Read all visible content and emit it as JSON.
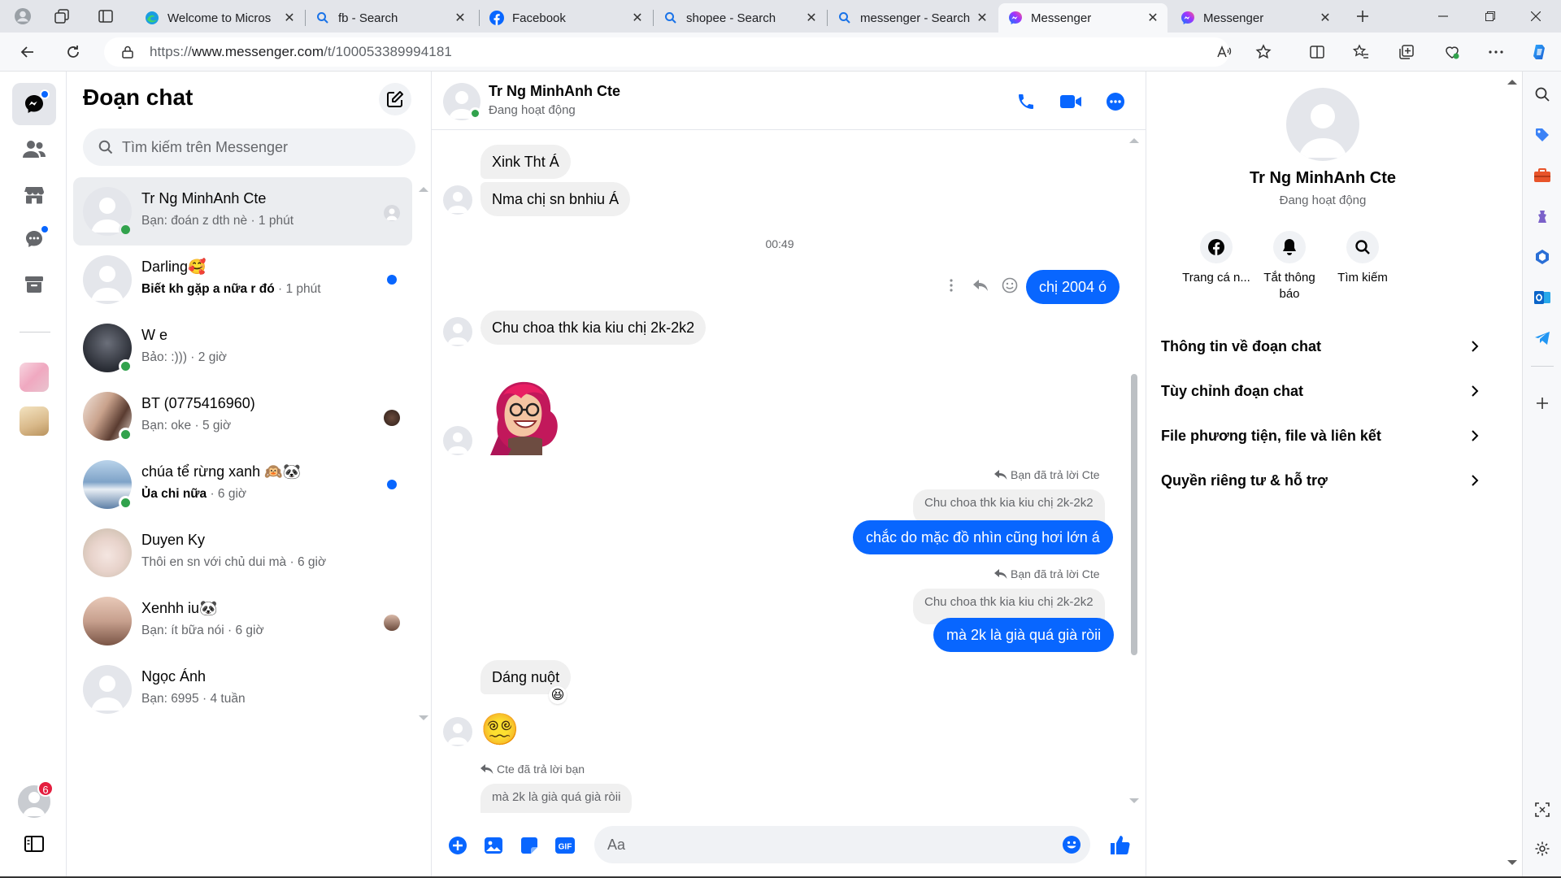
{
  "browser": {
    "tabs": [
      {
        "title": "Welcome to Micros",
        "icon": "edge-icon"
      },
      {
        "title": "fb - Search",
        "icon": "search-icon"
      },
      {
        "title": "Facebook",
        "icon": "facebook-icon"
      },
      {
        "title": "shopee - Search",
        "icon": "search-icon"
      },
      {
        "title": "messenger - Search",
        "icon": "search-icon"
      },
      {
        "title": "Messenger",
        "icon": "messenger-icon",
        "active": true
      },
      {
        "title": "Messenger",
        "icon": "messenger-icon"
      }
    ],
    "url_prefix": "https://",
    "url_host": "www.messenger.com",
    "url_path": "/t/100053389994181"
  },
  "rail": {
    "notification_count": "6"
  },
  "chat_list": {
    "title": "Đoạn chat",
    "search_placeholder": "Tìm kiếm trên Messenger",
    "conversations": [
      {
        "name": "Tr Ng MinhAnh Cte",
        "preview": "Bạn: đoán z dth nè",
        "time": "1 phút",
        "online": true,
        "active": true,
        "unread": false,
        "avatar_color": "#e4e6eb"
      },
      {
        "name": "Darling🥰",
        "preview": "Biết kh gặp a nữa r đó",
        "time": "1 phút",
        "online": false,
        "unread": true,
        "avatar_color": "#e4e6eb"
      },
      {
        "name": "W e",
        "preview": "Bảo: :)))",
        "time": "2 giờ",
        "online": true,
        "unread": false,
        "avatar_color": "#3a3f4a"
      },
      {
        "name": "BT (0775416960)",
        "preview": "Bạn: oke",
        "time": "5 giờ",
        "online": true,
        "unread": false,
        "avatar_color": "#8a6a5a"
      },
      {
        "name": "chúa tể rừng xanh 🙉🐼",
        "preview": "Ủa chi nữa",
        "time": "6 giờ",
        "online": true,
        "unread": true,
        "avatar_color": "#7fa3c8"
      },
      {
        "name": "Duyen Ky",
        "preview": "Thôi en sn với chủ dui mà",
        "time": "6 giờ",
        "online": false,
        "unread": false,
        "avatar_color": "#e8d6cf"
      },
      {
        "name": "Xenhh iu🐼",
        "preview": "Bạn: ít bữa nói",
        "time": "6 giờ",
        "online": false,
        "unread": false,
        "avatar_color": "#b08878"
      },
      {
        "name": "Ngọc Ánh",
        "preview": "Bạn: 6995",
        "time": "4 tuần",
        "online": false,
        "unread": false,
        "avatar_color": "#e4e6eb"
      }
    ]
  },
  "conversation": {
    "name": "Tr Ng MinhAnh Cte",
    "status": "Đang hoạt động",
    "messages": {
      "m1": "Xink Tht Á",
      "m2": "Nma chị sn bnhiu Á",
      "time1": "00:49",
      "m3": "chị 2004 ó",
      "m4": "Chu choa thk kia kiu chị 2k-2k2",
      "reply1_label": "Bạn đã trả lời Cte",
      "reply1_quote": "Chu choa thk kia kiu chị 2k-2k2",
      "m5": "chắc do mặc đồ nhìn cũng hơi lớn á",
      "reply2_label": "Bạn đã trả lời Cte",
      "reply2_quote": "Chu choa thk kia kiu chị 2k-2k2",
      "m6": "mà 2k là già quá già ròii",
      "m7": "Dáng nuột",
      "m7_reaction": "😆",
      "m8_emoji": "😵‍💫",
      "reply3_label": "Cte đã trả lời bạn",
      "reply3_quote": "mà 2k là già quá già ròii"
    },
    "composer_placeholder": "Aa"
  },
  "info_panel": {
    "name": "Tr Ng MinhAnh Cte",
    "status": "Đang hoạt động",
    "actions": [
      "Trang cá n...",
      "Tắt thông báo",
      "Tìm kiếm"
    ],
    "rows": [
      "Thông tin về đoạn chat",
      "Tùy chỉnh đoạn chat",
      "File phương tiện, file và liên kết",
      "Quyền riêng tư & hỗ trợ"
    ]
  },
  "colors": {
    "accent": "#0866ff",
    "online": "#31a24c",
    "bubble_in": "#f0f0f0"
  }
}
